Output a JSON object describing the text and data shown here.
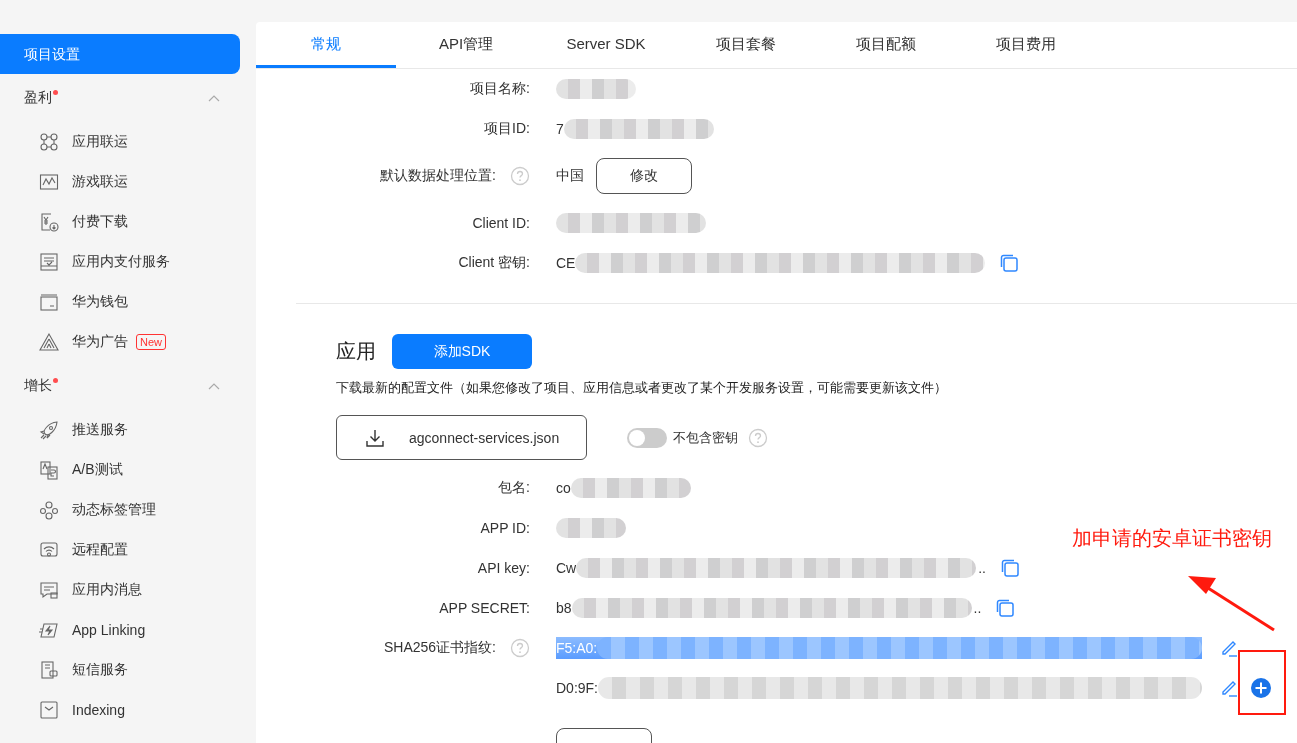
{
  "sidebar": {
    "top_item": {
      "label": "项目设置",
      "selected": true
    },
    "groups": [
      {
        "title": "盈利",
        "dot": true,
        "expanded": true,
        "items": [
          {
            "label": "应用联运"
          },
          {
            "label": "游戏联运"
          },
          {
            "label": "付费下载"
          },
          {
            "label": "应用内支付服务"
          },
          {
            "label": "华为钱包"
          },
          {
            "label": "华为广告",
            "badge": "New"
          }
        ]
      },
      {
        "title": "增长",
        "dot": true,
        "expanded": true,
        "items": [
          {
            "label": "推送服务"
          },
          {
            "label": "A/B测试"
          },
          {
            "label": "动态标签管理"
          },
          {
            "label": "远程配置"
          },
          {
            "label": "应用内消息"
          },
          {
            "label": "App Linking"
          },
          {
            "label": "短信服务"
          },
          {
            "label": "Indexing"
          }
        ]
      }
    ]
  },
  "tabs": [
    {
      "label": "常规",
      "selected": true
    },
    {
      "label": "API管理",
      "selected": false
    },
    {
      "label": "Server SDK",
      "selected": false
    },
    {
      "label": "项目套餐",
      "selected": false
    },
    {
      "label": "项目配额",
      "selected": false
    },
    {
      "label": "项目费用",
      "selected": false
    }
  ],
  "project_fields": [
    {
      "label": "项目名称:",
      "kind": "redacted",
      "help": false,
      "copy": false
    },
    {
      "label": "项目ID:",
      "kind": "redacted",
      "help": false,
      "value": "7",
      "copy": false
    },
    {
      "label": "默认数据处理位置:",
      "kind": "choice",
      "help": true,
      "value": "中国",
      "button": "修改",
      "copy": false
    },
    {
      "label": "Client ID:",
      "kind": "redacted",
      "help": false,
      "copy": false
    },
    {
      "label": "Client 密钥:",
      "kind": "redacted",
      "help": false,
      "value": "CE",
      "copy": true
    }
  ],
  "app_section": {
    "title": "应用",
    "add_button": "添加SDK",
    "description": "下载最新的配置文件（如果您修改了项目、应用信息或者更改了某个开发服务设置，可能需要更新该文件）",
    "download_button": "agconnect-services.json",
    "toggle": {
      "label": "不包含密钥",
      "on": false,
      "help": true
    }
  },
  "app_fields": [
    {
      "label": "包名:",
      "kind": "redacted",
      "help": false,
      "value": "co",
      "copy": false
    },
    {
      "label": "APP ID:",
      "kind": "redacted",
      "help": false,
      "copy": false
    },
    {
      "label": "API key:",
      "kind": "redacted",
      "help": false,
      "value": "Cw",
      "ellipsis": "..",
      "copy": true
    },
    {
      "label": "APP SECRET:",
      "kind": "redacted",
      "help": false,
      "value": "b8",
      "ellipsis": "..",
      "copy": true
    }
  ],
  "fingerprints": {
    "label": "SHA256证书指纹:",
    "help": true,
    "items": [
      {
        "value": "F5:A0:",
        "selected": true,
        "add": false
      },
      {
        "value": "D0:9F:",
        "selected": false,
        "add": true
      }
    ]
  },
  "annotation": {
    "text": "加申请的安卓证书密钥"
  }
}
